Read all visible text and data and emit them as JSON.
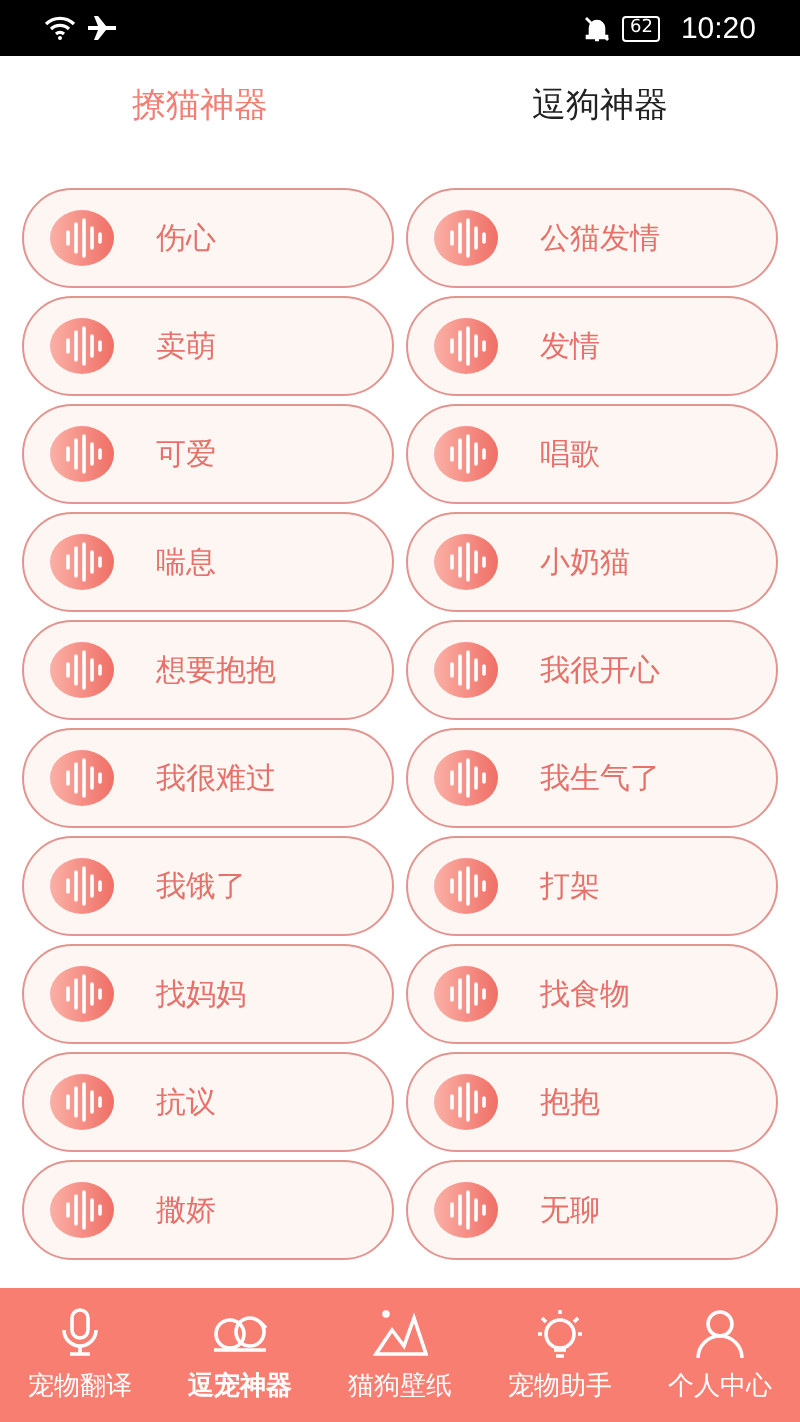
{
  "status_bar": {
    "time": "10:20",
    "battery": "62"
  },
  "tabs": [
    {
      "label": "撩猫神器",
      "selected": true
    },
    {
      "label": "逗狗神器",
      "selected": false
    }
  ],
  "sounds": [
    "伤心",
    "公猫发情",
    "卖萌",
    "发情",
    "可爱",
    "唱歌",
    "喘息",
    "小奶猫",
    "想要抱抱",
    "我很开心",
    "我很难过",
    "我生气了",
    "我饿了",
    "打架",
    "找妈妈",
    "找食物",
    "抗议",
    "抱抱",
    "撒娇",
    "无聊"
  ],
  "nav": [
    {
      "label": "宠物翻译",
      "kind": "mic",
      "selected": false
    },
    {
      "label": "逗宠神器",
      "kind": "pets",
      "selected": true
    },
    {
      "label": "猫狗壁纸",
      "kind": "mountain",
      "selected": false
    },
    {
      "label": "宠物助手",
      "kind": "bulb",
      "selected": false
    },
    {
      "label": "个人中心",
      "kind": "person",
      "selected": false
    }
  ]
}
